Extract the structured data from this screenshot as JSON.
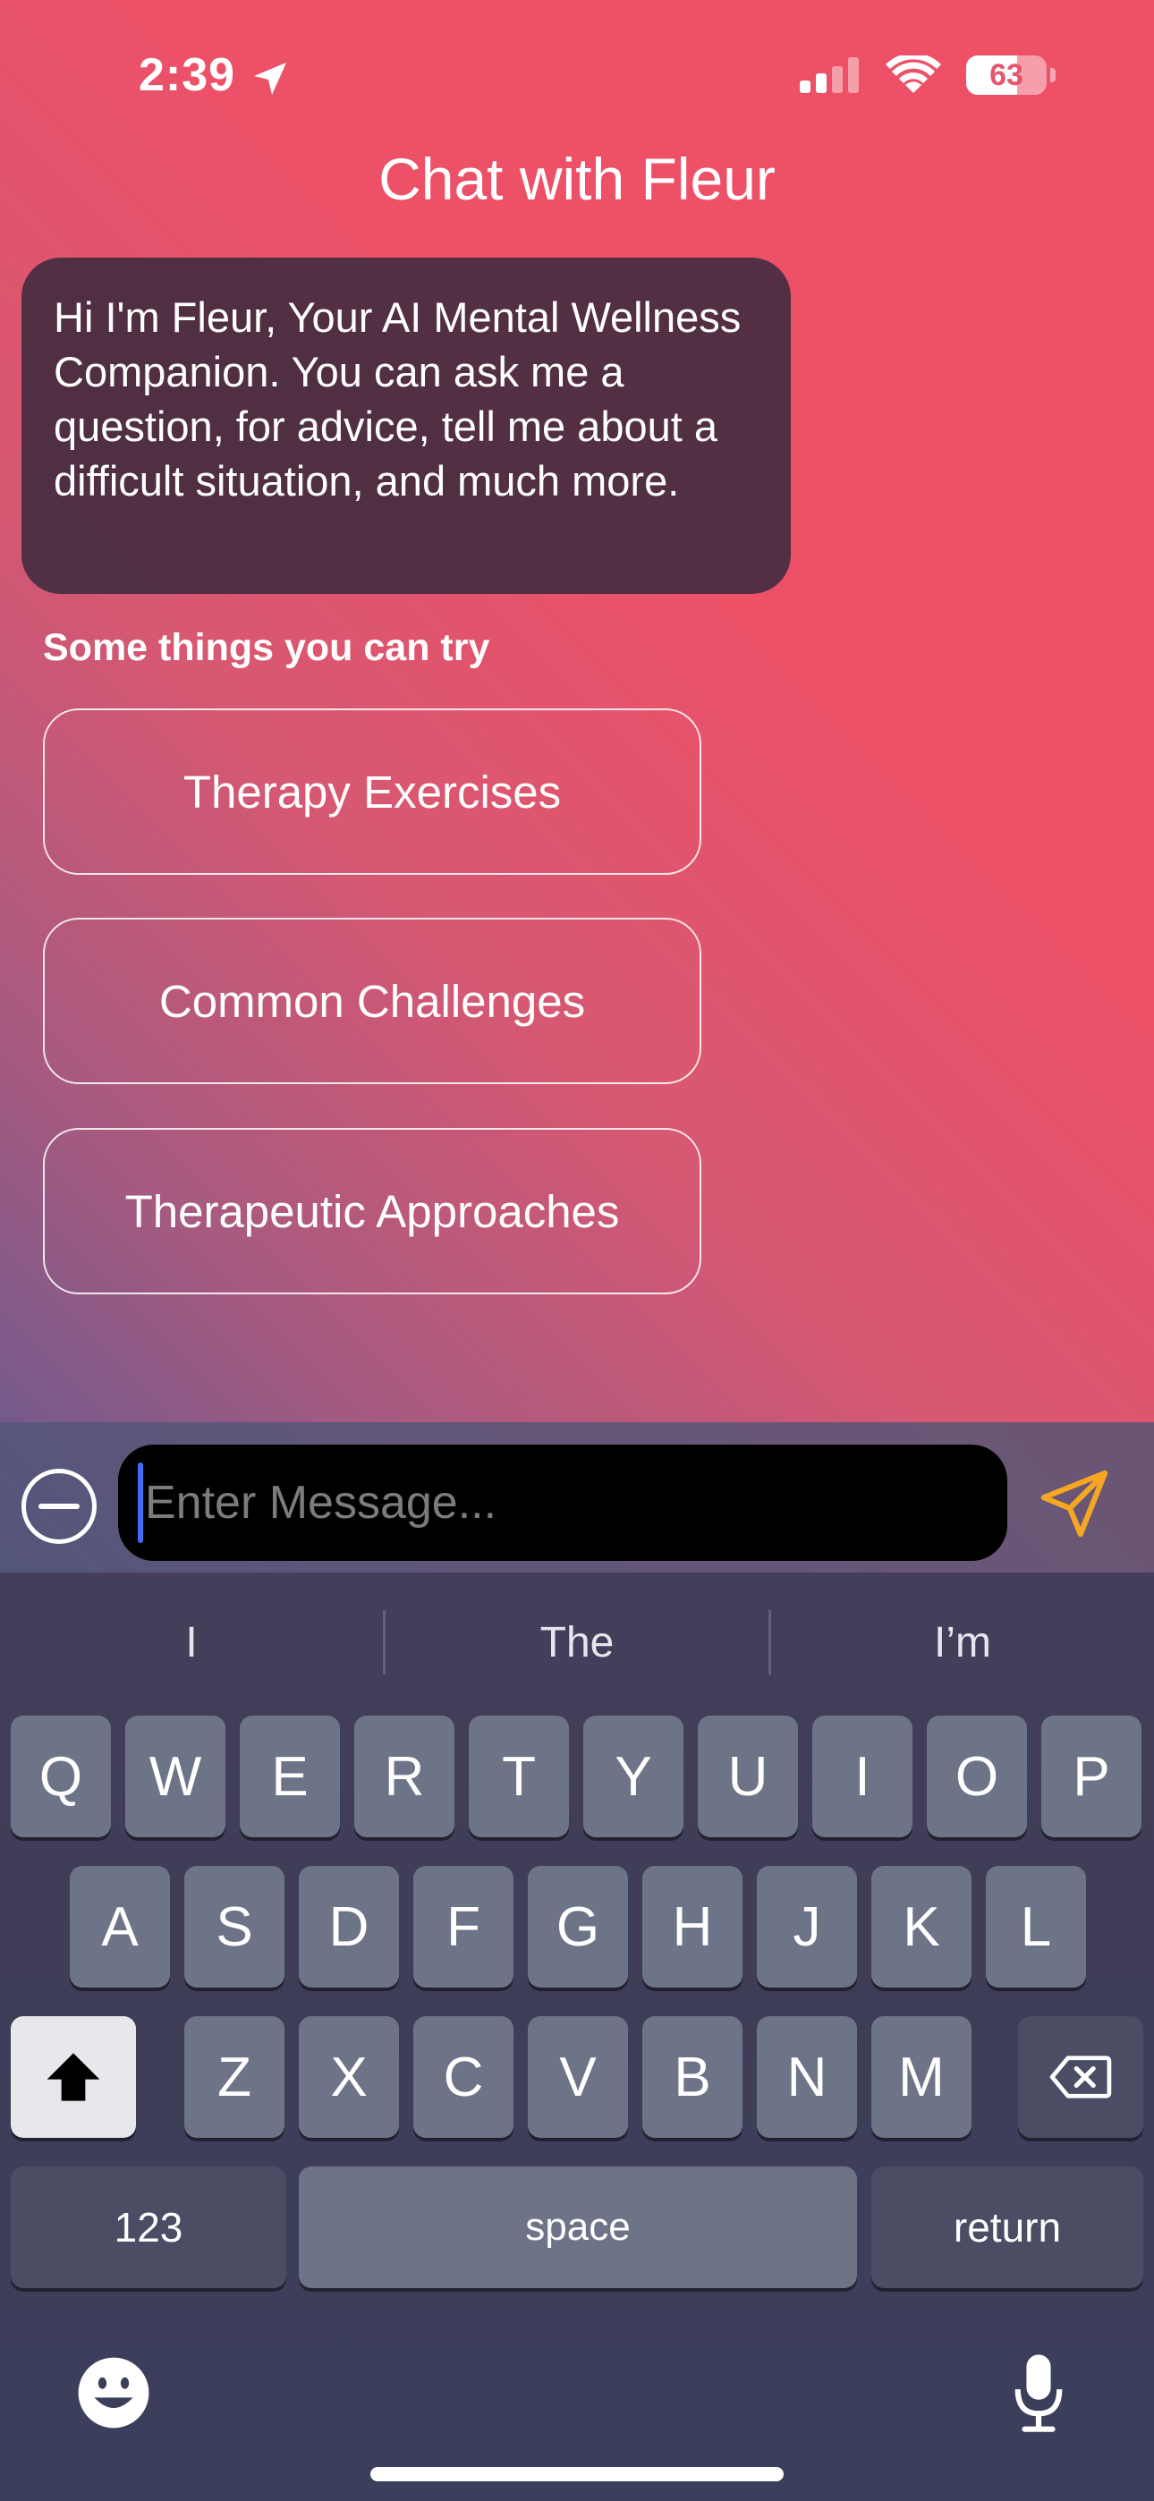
{
  "status": {
    "time": "2:39",
    "battery": "63"
  },
  "header": {
    "title": "Chat with Fleur"
  },
  "chat": {
    "greeting": "Hi I'm Fleur, Your AI Mental Wellness Companion. You can ask me a question, for advice, tell me about a difficult situation, and much more.",
    "try_label": "Some things you can try",
    "suggestions": [
      "Therapy Exercises",
      "Common Challenges",
      "Therapeutic Approaches"
    ]
  },
  "composer": {
    "placeholder": "Enter Message...",
    "value": ""
  },
  "keyboard": {
    "predictions": [
      "I",
      "The",
      "I’m"
    ],
    "row1": [
      "Q",
      "W",
      "E",
      "R",
      "T",
      "Y",
      "U",
      "I",
      "O",
      "P"
    ],
    "row2": [
      "A",
      "S",
      "D",
      "F",
      "G",
      "H",
      "J",
      "K",
      "L"
    ],
    "row3": [
      "Z",
      "X",
      "C",
      "V",
      "B",
      "N",
      "M"
    ],
    "numbers_label": "123",
    "space_label": "space",
    "return_label": "return"
  },
  "icons": {
    "location": "location-arrow-icon",
    "signal": "cellular-signal-icon",
    "wifi": "wifi-icon",
    "send": "paper-plane-icon",
    "minus": "minus-circle-icon",
    "emoji": "emoji-icon",
    "mic": "microphone-icon",
    "shift": "shift-icon",
    "delete": "backspace-icon"
  },
  "colors": {
    "accent_send": "#f5a623",
    "caret": "#3e6cf5"
  }
}
